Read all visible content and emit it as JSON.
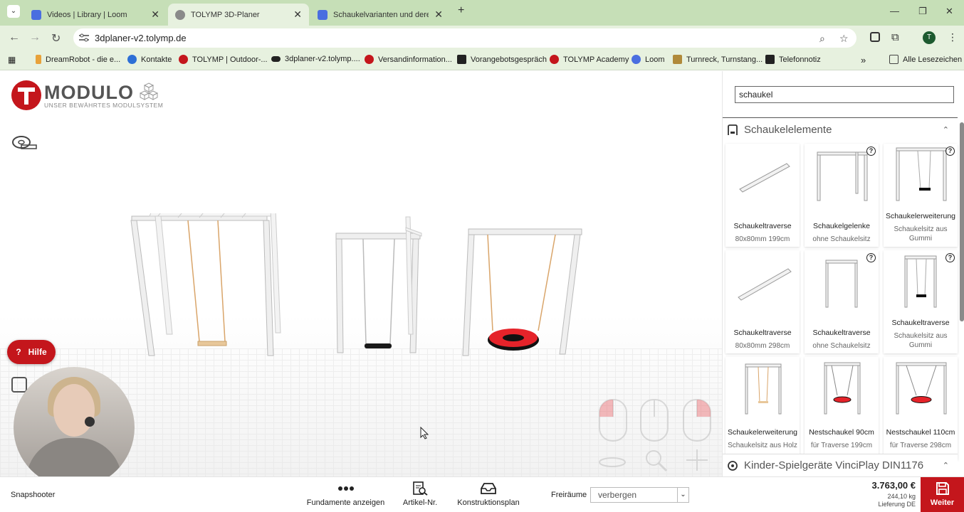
{
  "browser": {
    "tabs": [
      {
        "label": "Videos | Library | Loom",
        "active": false,
        "favicon_color": "#4a6ee0"
      },
      {
        "label": "TOLYMP 3D-Planer",
        "active": true,
        "favicon_color": "#8a8a8a"
      },
      {
        "label": "Schaukelvarianten und deren A",
        "active": false,
        "favicon_color": "#4a6ee0"
      }
    ],
    "url": "3dplaner-v2.tolymp.de",
    "profile_initial": "T",
    "bookmarks": [
      {
        "label": "DreamRobot - die e..."
      },
      {
        "label": "Kontakte"
      },
      {
        "label": "TOLYMP | Outdoor-..."
      },
      {
        "label": "3dplaner-v2.tolymp...."
      },
      {
        "label": "Versandinformation..."
      },
      {
        "label": "Vorangebotsgespräch"
      },
      {
        "label": "TOLYMP Academy"
      },
      {
        "label": "Loom"
      },
      {
        "label": "Turnreck, Turnstang..."
      },
      {
        "label": "Telefonnotiz"
      }
    ],
    "all_bookmarks": "Alle Lesezeichen"
  },
  "logo": {
    "title": "MODULO",
    "subtitle": "UNSER BEWÄHRTES MODULSYSTEM"
  },
  "help_button": {
    "label": "Hilfe"
  },
  "search": {
    "value": "schaukel"
  },
  "categories": [
    {
      "label": "Schaukelelemente"
    },
    {
      "label": "Kinder-Spielgeräte VinciPlay DIN1176"
    }
  ],
  "products": [
    {
      "name": "Schaukeltraverse",
      "sub": "80x80mm 199cm",
      "help": false
    },
    {
      "name": "Schaukelgelenke",
      "sub": "ohne Schaukelsitz",
      "help": true
    },
    {
      "name": "Schaukelerweiterung",
      "sub": "Schaukelsitz aus Gummi",
      "help": true
    },
    {
      "name": "Schaukeltraverse",
      "sub": "80x80mm 298cm",
      "help": false
    },
    {
      "name": "Schaukeltraverse",
      "sub": "ohne Schaukelsitz",
      "help": true
    },
    {
      "name": "Schaukeltraverse",
      "sub": "Schaukelsitz aus Gummi",
      "help": true
    },
    {
      "name": "Schaukelerweiterung",
      "sub": "Schaukelsitz aus Holz",
      "help": false
    },
    {
      "name": "Nestschaukel 90cm",
      "sub": "für Traverse 199cm",
      "help": false
    },
    {
      "name": "Nestschaukel 110cm",
      "sub": "für Traverse 298cm",
      "help": false
    }
  ],
  "bottombar": {
    "snapshooter": "Snapshooter",
    "fundamente": "Fundamente anzeigen",
    "artikel": "Artikel-Nr.",
    "konstruktionsplan": "Konstruktionsplan",
    "freiraeume_label": "Freiräume",
    "freiraeume_value": "verbergen",
    "price": "3.763,00 €",
    "weight": "244,10 kg",
    "delivery": "Lieferung DE",
    "weiter": "Weiter"
  },
  "colors": {
    "brand_red": "#c4161c",
    "chrome_green": "#c6dfb7"
  }
}
